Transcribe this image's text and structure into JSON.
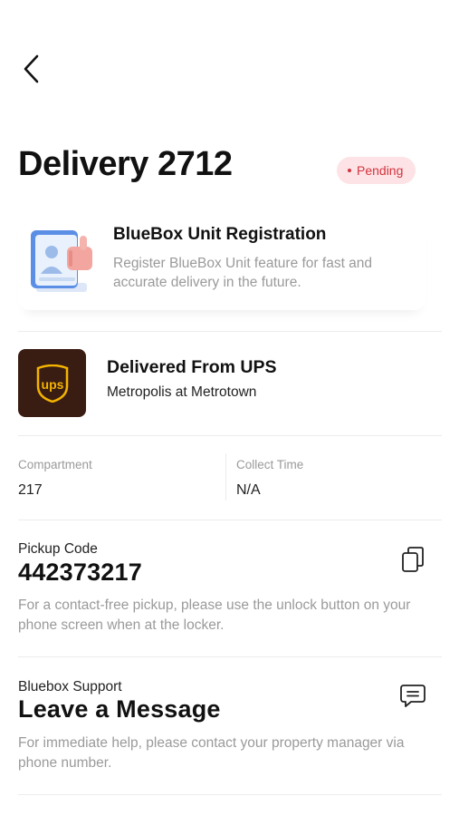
{
  "header": {
    "title": "Delivery 2712",
    "status_badge": "Pending",
    "status_color": "#d1343f",
    "status_bg": "#fde3e5"
  },
  "promo": {
    "title": "BlueBox Unit Registration",
    "description": "Register BlueBox Unit feature for fast and accurate delivery in the future.",
    "illustration_icon": "thumbs-up-registration-icon"
  },
  "courier": {
    "logo_text": "ups",
    "logo_bg": "#3a1d12",
    "logo_accent": "#f4b400",
    "title": "Delivered From UPS",
    "location": "Metropolis at Metrotown"
  },
  "details": {
    "compartment_label": "Compartment",
    "compartment_value": "217",
    "collect_time_label": "Collect Time",
    "collect_time_value": "N/A"
  },
  "pickup": {
    "label": "Pickup Code",
    "code": "442373217",
    "description": "For a contact-free pickup, please use the unlock button on your phone screen when at the locker.",
    "action_icon": "copy-icon"
  },
  "support": {
    "label": "Bluebox Support",
    "title": "Leave a Message",
    "description": "For immediate help, please contact your property manager via phone number.",
    "action_icon": "message-icon"
  }
}
